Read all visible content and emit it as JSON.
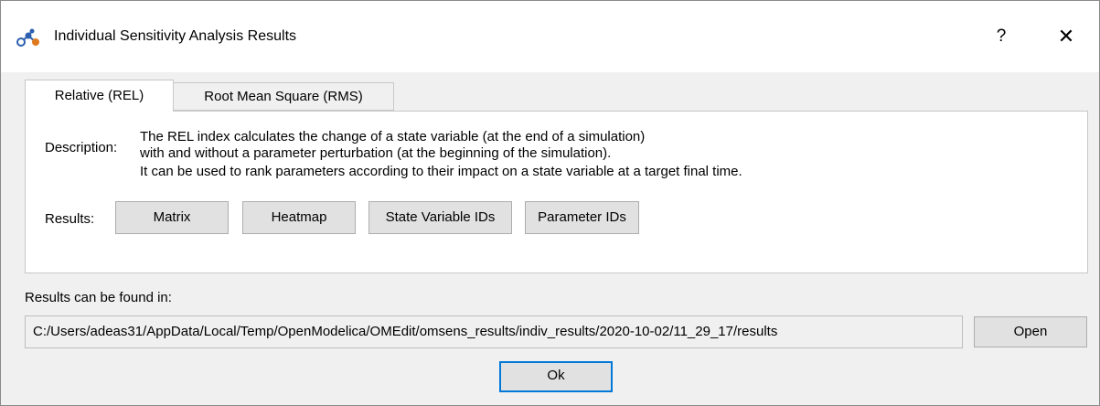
{
  "window": {
    "title": "Individual Sensitivity Analysis Results",
    "app_icon": "network-nodes-icon",
    "help_label": "?",
    "close_label": "✕"
  },
  "tabs": [
    {
      "label": "Relative (REL)",
      "active": true
    },
    {
      "label": "Root Mean Square (RMS)",
      "active": false
    }
  ],
  "description": {
    "label": "Description:",
    "lines": [
      "The REL index calculates the change of a state variable (at the end of a simulation)",
      "with and without a parameter perturbation (at the beginning of the simulation).",
      "It can be used to rank parameters according to their impact on a state variable at a target final time."
    ]
  },
  "results": {
    "label": "Results:",
    "buttons": [
      "Matrix",
      "Heatmap",
      "State Variable IDs",
      "Parameter IDs"
    ]
  },
  "location": {
    "label": "Results can be found in:",
    "path": "C:/Users/adeas31/AppData/Local/Temp/OpenModelica/OMEdit/omsens_results/indiv_results/2020-10-02/11_29_17/results",
    "open_label": "Open"
  },
  "footer": {
    "ok_label": "Ok"
  },
  "colors": {
    "accent": "#0078d7",
    "icon_blue": "#2b5fae",
    "icon_orange": "#e07a1f"
  }
}
